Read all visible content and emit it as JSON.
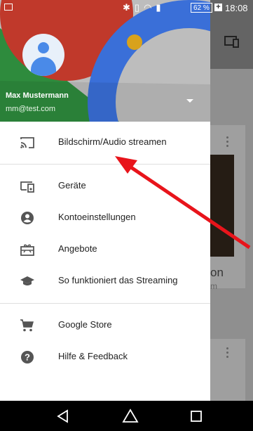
{
  "status_bar": {
    "battery": "62 %",
    "charging": "+",
    "time": "18:08"
  },
  "drawer": {
    "header": {
      "user_name": "Max Mustermann",
      "user_email": "mm@test.com"
    },
    "primary_items": [
      {
        "label": "Bildschirm/Audio streamen",
        "icon": "cast-icon"
      }
    ],
    "secondary_items": [
      {
        "label": "Geräte",
        "icon": "devices-icon"
      },
      {
        "label": "Kontoeinstellungen",
        "icon": "account-circle-icon"
      },
      {
        "label": "Angebote",
        "icon": "offers-icon"
      },
      {
        "label": "So funktioniert das Streaming",
        "icon": "school-icon"
      }
    ],
    "footer_items": [
      {
        "label": "Google Store",
        "icon": "shopping-cart-icon"
      },
      {
        "label": "Hilfe & Feedback",
        "icon": "help-icon"
      }
    ]
  },
  "background": {
    "card_text": "on",
    "card_sub": "m"
  },
  "colors": {
    "annotation_arrow": "#e8141b",
    "header_red": "#c0392b",
    "header_green": "#2e8b3d",
    "header_blue": "#3a6fd8",
    "header_yellow": "#d8a21c"
  }
}
